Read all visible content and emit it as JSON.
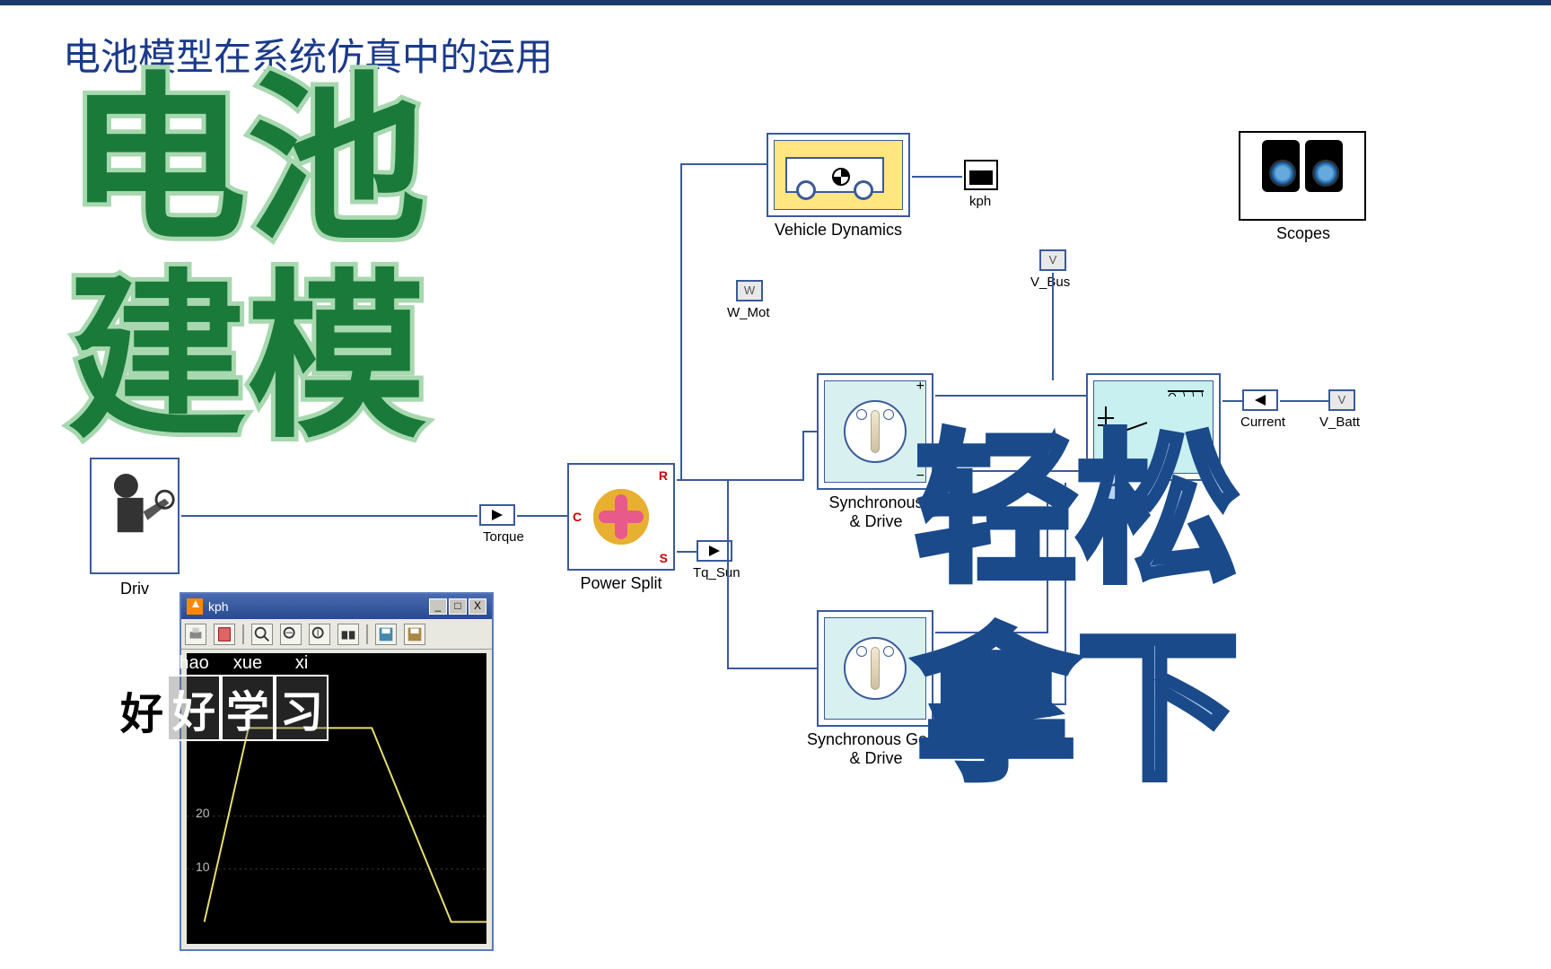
{
  "page_title": "电池模型在系统仿真中的运用",
  "overlay_green": {
    "line1": "电池",
    "line2": "建模"
  },
  "overlay_blue": {
    "line1": "轻松",
    "line2": "拿下"
  },
  "subtitle": {
    "chars": [
      "好",
      "好",
      "学",
      "习"
    ],
    "pinyin": {
      "1": "hao",
      "2": "xue",
      "3": "xi"
    }
  },
  "blocks": {
    "driver": "Driv",
    "torque": "Torque",
    "power_split": {
      "label": "Power Split",
      "ports": {
        "c": "C",
        "r": "R",
        "s": "S"
      }
    },
    "tq_sun": "Tq_Sun",
    "w_mot": {
      "tag": "W",
      "label": "W_Mot"
    },
    "vehicle_dynamics": "Vehicle Dynamics",
    "kph": "kph",
    "v_bus": {
      "tag": "V",
      "label": "V_Bus"
    },
    "sync_motor": "Synchronous\n& Drive",
    "sync_gen": "Synchronous Gene\n& Drive",
    "current": "Current",
    "v_batt": {
      "tag": "V",
      "label": "V_Batt"
    },
    "scopes": "Scopes"
  },
  "scope_window": {
    "title": "kph",
    "toolbar_icons": [
      "print",
      "params",
      "zoom-in",
      "zoom-x",
      "zoom-y",
      "autoscale",
      "binoculars",
      "save",
      "restore"
    ],
    "window_buttons": {
      "min": "_",
      "max": "□",
      "close": "X"
    },
    "ylabels": [
      "20",
      "10"
    ],
    "plot_hint": "trapezoidal speed profile"
  },
  "chart_data": {
    "type": "line",
    "title": "kph",
    "xlabel": "",
    "ylabel": "",
    "ylim": [
      0,
      40
    ],
    "series": [
      {
        "name": "kph",
        "x": [
          0,
          5,
          20,
          35,
          45
        ],
        "y": [
          0,
          30,
          30,
          0,
          0
        ],
        "color": "#e8e070"
      }
    ]
  }
}
